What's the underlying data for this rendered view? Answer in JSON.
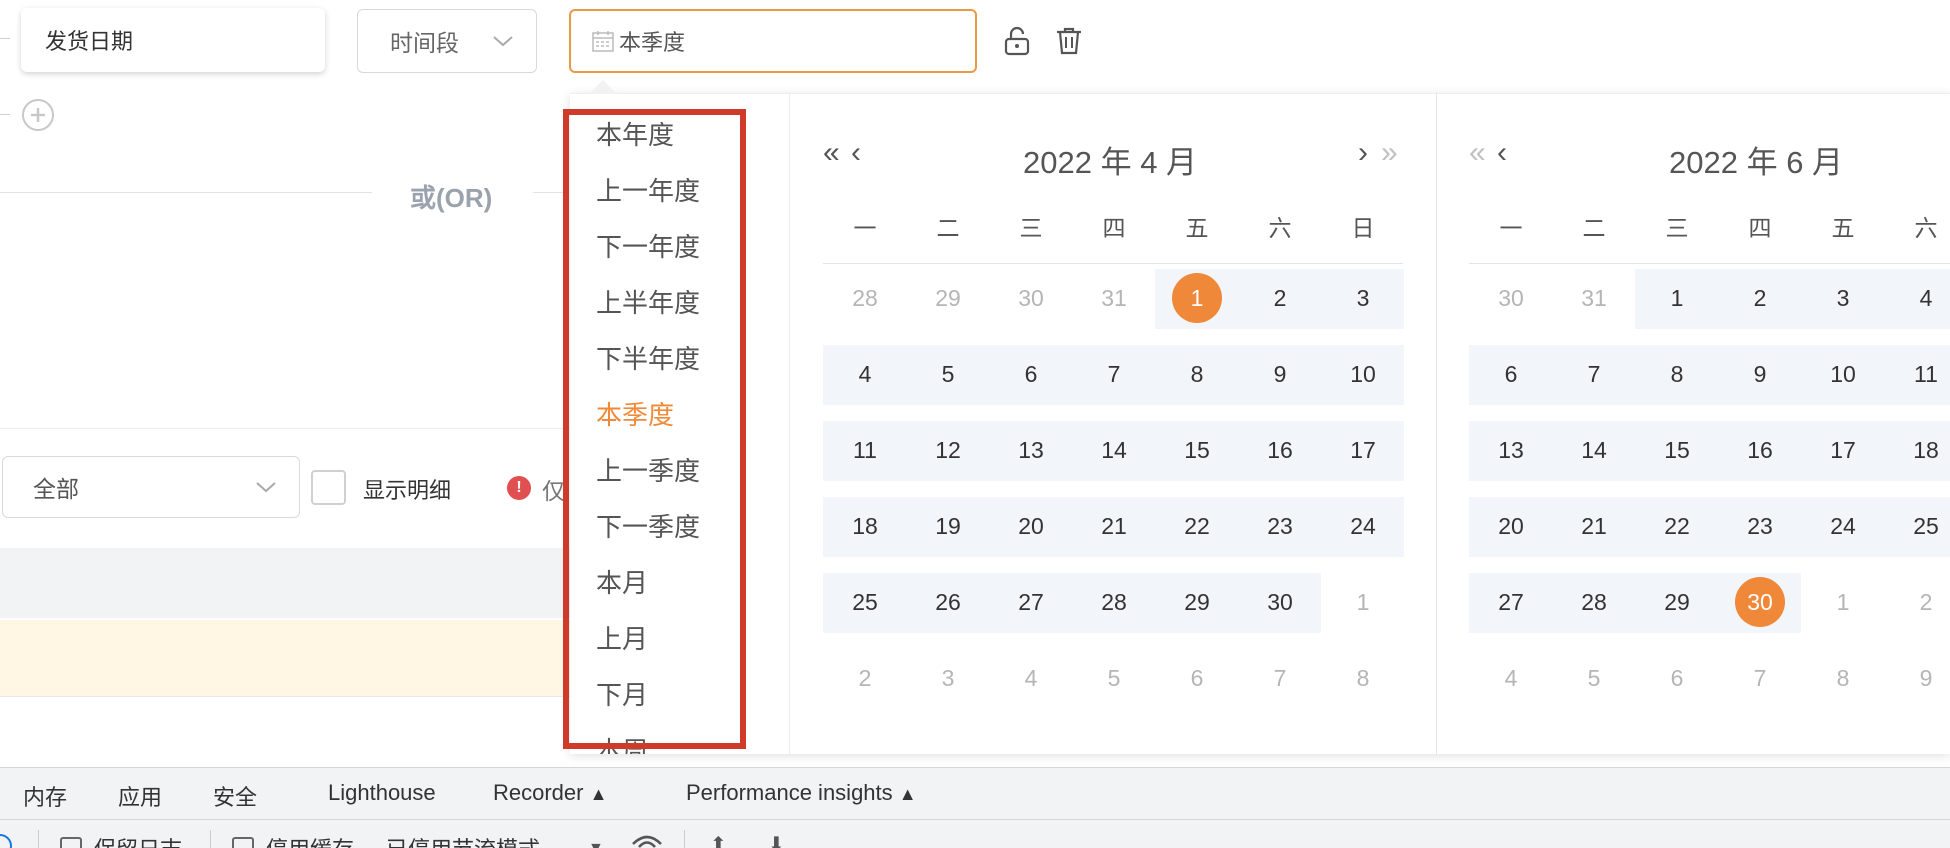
{
  "filter": {
    "field_name": "发货日期",
    "period_type": "时间段",
    "date_value": "本季度",
    "add_icon": "plus-circle-icon",
    "lock_icon": "unlock-icon",
    "delete_icon": "trash-icon"
  },
  "divider": {
    "or_label": "或(OR)"
  },
  "options": {
    "scope_value": "全部",
    "show_detail_label": "显示明细",
    "warning_label": "仅"
  },
  "presets": {
    "items": [
      "本年度",
      "上一年度",
      "下一年度",
      "上半年度",
      "下半年度",
      "本季度",
      "上一季度",
      "下一季度",
      "本月",
      "上月",
      "下月",
      "本周"
    ],
    "active": "本季度"
  },
  "weekdays": [
    "一",
    "二",
    "三",
    "四",
    "五",
    "六",
    "日"
  ],
  "calendars": [
    {
      "title": "2022 年 4 月",
      "weeks": [
        [
          "28",
          "29",
          "30",
          "31",
          "1",
          "2",
          "3"
        ],
        [
          "4",
          "5",
          "6",
          "7",
          "8",
          "9",
          "10"
        ],
        [
          "11",
          "12",
          "13",
          "14",
          "15",
          "16",
          "17"
        ],
        [
          "18",
          "19",
          "20",
          "21",
          "22",
          "23",
          "24"
        ],
        [
          "25",
          "26",
          "27",
          "28",
          "29",
          "30",
          "1"
        ],
        [
          "2",
          "3",
          "4",
          "5",
          "6",
          "7",
          "8"
        ]
      ],
      "selected_day": "1"
    },
    {
      "title": "2022 年 6 月",
      "weeks": [
        [
          "30",
          "31",
          "1",
          "2",
          "3",
          "4"
        ],
        [
          "6",
          "7",
          "8",
          "9",
          "10",
          "11"
        ],
        [
          "13",
          "14",
          "15",
          "16",
          "17",
          "18"
        ],
        [
          "20",
          "21",
          "22",
          "23",
          "24",
          "25"
        ],
        [
          "27",
          "28",
          "29",
          "30",
          "1",
          "2"
        ],
        [
          "4",
          "5",
          "6",
          "7",
          "8",
          "9"
        ]
      ],
      "selected_day": "30"
    }
  ],
  "devtools": {
    "tabs": [
      "内存",
      "应用",
      "安全",
      "Lighthouse",
      "Recorder",
      "Performance insights"
    ],
    "preserve_log": "保留日志",
    "disable_cache": "停用缓存",
    "throttling": "已停用节流模式"
  },
  "colors": {
    "accent": "#f0883a",
    "highlight_box": "#d03a2b",
    "range_bg": "#f2f5f9"
  }
}
